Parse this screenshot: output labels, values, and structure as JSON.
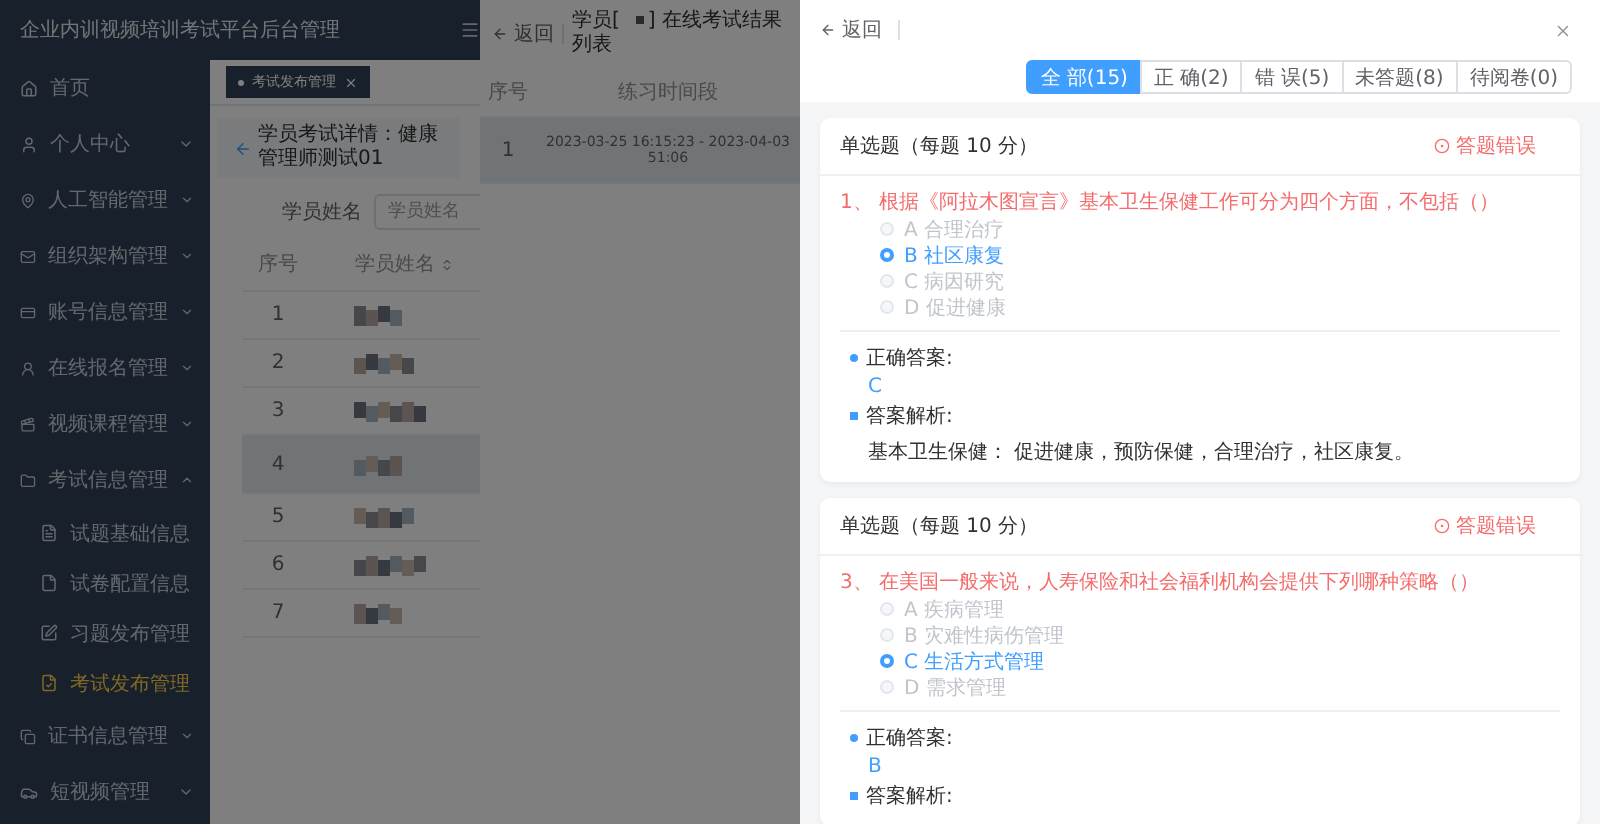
{
  "app_title": "企业内训视频培训考试平台后台管理",
  "sidebar": {
    "items": [
      {
        "label": "首页",
        "kind": "link"
      },
      {
        "label": "个人中心",
        "kind": "group",
        "expanded": false
      },
      {
        "label": "人工智能管理",
        "kind": "group",
        "expanded": false
      },
      {
        "label": "组织架构管理",
        "kind": "group",
        "expanded": false
      },
      {
        "label": "账号信息管理",
        "kind": "group",
        "expanded": false
      },
      {
        "label": "在线报名管理",
        "kind": "group",
        "expanded": false
      },
      {
        "label": "视频课程管理",
        "kind": "group",
        "expanded": false
      },
      {
        "label": "考试信息管理",
        "kind": "group",
        "expanded": true,
        "children": [
          {
            "label": "试题基础信息",
            "selected": false
          },
          {
            "label": "试卷配置信息",
            "selected": false
          },
          {
            "label": "习题发布管理",
            "selected": false
          },
          {
            "label": "考试发布管理",
            "selected": true
          }
        ]
      },
      {
        "label": "证书信息管理",
        "kind": "group",
        "expanded": false
      },
      {
        "label": "短视频管理",
        "kind": "group",
        "expanded": false
      }
    ]
  },
  "tabs": [
    {
      "label": "考试发布管理",
      "selected": true
    }
  ],
  "page": {
    "title": "学员考试详情：健康管理师测试01",
    "filter": {
      "label": "学员姓名",
      "placeholder": "学员姓名"
    },
    "table": {
      "columns": [
        "序号",
        "学员姓名"
      ],
      "rows": [
        {
          "index": "1",
          "selected": false
        },
        {
          "index": "2",
          "selected": false
        },
        {
          "index": "3",
          "selected": false
        },
        {
          "index": "4",
          "selected": true
        },
        {
          "index": "5",
          "selected": false
        },
        {
          "index": "6",
          "selected": false
        },
        {
          "index": "7",
          "selected": false
        }
      ]
    }
  },
  "result_drawer": {
    "back": "返回",
    "title_prefix": "学员[",
    "title_suffix": "] 在线考试结果列表",
    "columns": [
      "序号",
      "练习时间段"
    ],
    "rows": [
      {
        "index": "1",
        "period_line_1": "2023-03-25 16:15:23 - 2023-04-03",
        "period_line_2": "51:06",
        "selected": true
      }
    ]
  },
  "answer_drawer": {
    "back": "返回",
    "filters": [
      {
        "label": "全 部(15)",
        "selected": true
      },
      {
        "label": "正 确(2)",
        "selected": false
      },
      {
        "label": "错 误(5)",
        "selected": false
      },
      {
        "label": "未答题(8)",
        "selected": false
      },
      {
        "label": "待阅卷(0)",
        "selected": false
      }
    ],
    "questions": [
      {
        "type_label": "单选题（每题 10 分）",
        "status": "答题错误",
        "question": "1、 根据《阿拉木图宣言》基本卫生保健工作可分为四个方面，不包括（）",
        "options": [
          {
            "label": "A 合理治疗",
            "selected": false
          },
          {
            "label": "B 社区康复",
            "selected": true
          },
          {
            "label": "C 病因研究",
            "selected": false
          },
          {
            "label": "D 促进健康",
            "selected": false
          }
        ],
        "correct_label": "正确答案:",
        "correct": "C",
        "analysis_label": "答案解析:",
        "analysis": "基本卫生保健： 促进健康，预防保健，合理治疗，社区康复。"
      },
      {
        "type_label": "单选题（每题 10 分）",
        "status": "答题错误",
        "question": "3、 在美国一般来说，人寿保险和社会福利机构会提供下列哪种策略（）",
        "options": [
          {
            "label": "A 疾病管理",
            "selected": false
          },
          {
            "label": "B 灾难性病伤管理",
            "selected": false
          },
          {
            "label": "C 生活方式管理",
            "selected": true
          },
          {
            "label": "D 需求管理",
            "selected": false
          }
        ],
        "correct_label": "正确答案:",
        "correct": "B",
        "analysis_label": "答案解析:"
      }
    ]
  }
}
